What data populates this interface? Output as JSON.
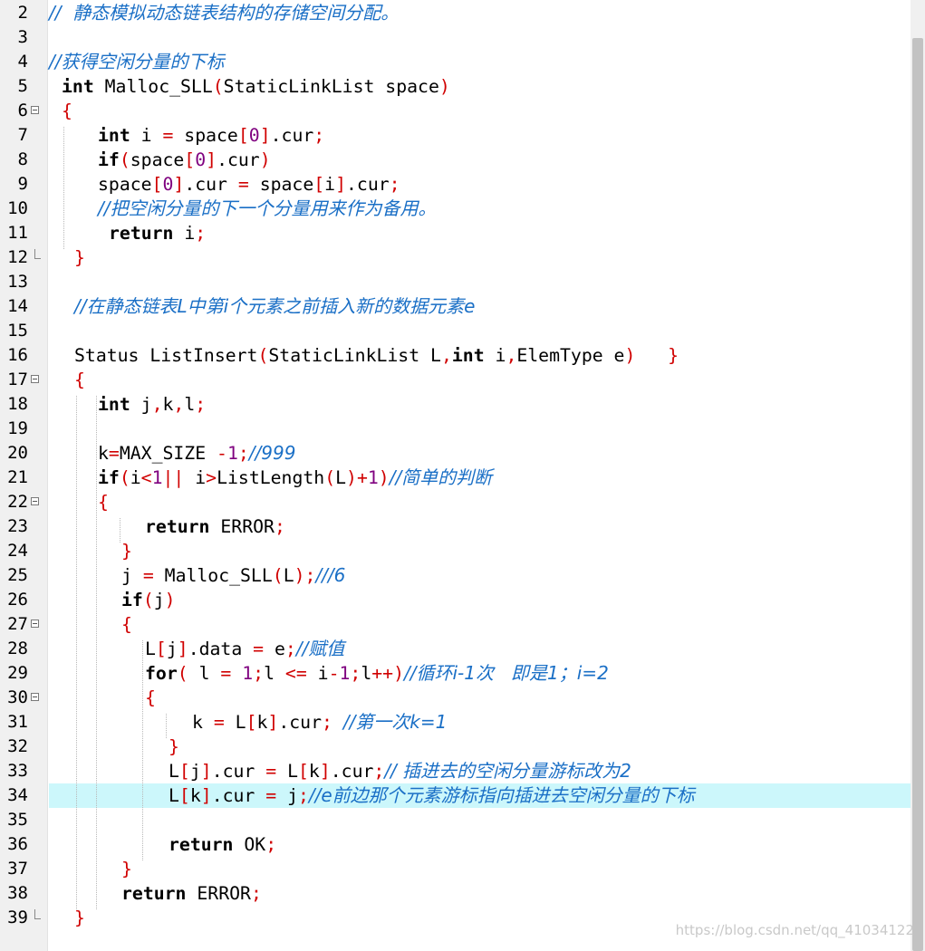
{
  "editor": {
    "current_line": "34",
    "lines": [
      {
        "n": "2",
        "segs": [
          [
            "c",
            "//  静态模拟动态链表结构的存储空间分配。"
          ]
        ]
      },
      {
        "n": "3",
        "segs": []
      },
      {
        "n": "4",
        "segs": [
          [
            "c",
            "//获得空闲分量的下标"
          ]
        ]
      },
      {
        "n": "5",
        "segs": [
          [
            "k",
            "int"
          ],
          [
            "t",
            " Malloc_SLL"
          ],
          [
            "p",
            "("
          ],
          [
            "t",
            "StaticLinkList space"
          ],
          [
            "p",
            ")"
          ]
        ]
      },
      {
        "n": "6",
        "segs": [
          [
            "p",
            "{"
          ]
        ]
      },
      {
        "n": "7",
        "segs": [
          [
            "k",
            "int"
          ],
          [
            "t",
            " i "
          ],
          [
            "p",
            "="
          ],
          [
            "t",
            " space"
          ],
          [
            "p",
            "["
          ],
          [
            "n",
            "0"
          ],
          [
            "p",
            "]"
          ],
          [
            "t",
            ".cur"
          ],
          [
            "p",
            ";"
          ]
        ]
      },
      {
        "n": "8",
        "segs": [
          [
            "k",
            "if"
          ],
          [
            "p",
            "("
          ],
          [
            "t",
            "space"
          ],
          [
            "p",
            "["
          ],
          [
            "n",
            "0"
          ],
          [
            "p",
            "]"
          ],
          [
            "t",
            ".cur"
          ],
          [
            "p",
            ")"
          ]
        ]
      },
      {
        "n": "9",
        "segs": [
          [
            "t",
            "space"
          ],
          [
            "p",
            "["
          ],
          [
            "n",
            "0"
          ],
          [
            "p",
            "]"
          ],
          [
            "t",
            ".cur "
          ],
          [
            "p",
            "="
          ],
          [
            "t",
            " space"
          ],
          [
            "p",
            "["
          ],
          [
            "t",
            "i"
          ],
          [
            "p",
            "]"
          ],
          [
            "t",
            ".cur"
          ],
          [
            "p",
            ";"
          ]
        ]
      },
      {
        "n": "10",
        "segs": [
          [
            "c",
            "//把空闲分量的下一个分量用来作为备用。"
          ]
        ]
      },
      {
        "n": "11",
        "segs": [
          [
            "k",
            "return"
          ],
          [
            "t",
            " i"
          ],
          [
            "p",
            ";"
          ]
        ]
      },
      {
        "n": "12",
        "segs": [
          [
            "p",
            "}"
          ]
        ]
      },
      {
        "n": "13",
        "segs": []
      },
      {
        "n": "14",
        "segs": [
          [
            "c",
            "//在静态链表L中第i个元素之前插入新的数据元素e"
          ]
        ]
      },
      {
        "n": "15",
        "segs": []
      },
      {
        "n": "16",
        "segs": [
          [
            "t",
            "Status ListInsert"
          ],
          [
            "p",
            "("
          ],
          [
            "t",
            "StaticLinkList L"
          ],
          [
            "p",
            ","
          ],
          [
            "k",
            "int"
          ],
          [
            "t",
            " i"
          ],
          [
            "p",
            ","
          ],
          [
            "t",
            "ElemType e"
          ],
          [
            "p",
            ")"
          ],
          [
            "t",
            "   "
          ],
          [
            "p",
            "}"
          ]
        ]
      },
      {
        "n": "17",
        "segs": [
          [
            "p",
            "{"
          ]
        ]
      },
      {
        "n": "18",
        "segs": [
          [
            "k",
            "int"
          ],
          [
            "t",
            " j"
          ],
          [
            "p",
            ","
          ],
          [
            "t",
            "k"
          ],
          [
            "p",
            ","
          ],
          [
            "t",
            "l"
          ],
          [
            "p",
            ";"
          ]
        ]
      },
      {
        "n": "19",
        "segs": []
      },
      {
        "n": "20",
        "segs": [
          [
            "t",
            "k"
          ],
          [
            "p",
            "="
          ],
          [
            "t",
            "MAX_SIZE "
          ],
          [
            "p",
            "-"
          ],
          [
            "n",
            "1"
          ],
          [
            "p",
            ";"
          ],
          [
            "c",
            "//999"
          ]
        ]
      },
      {
        "n": "21",
        "segs": [
          [
            "k",
            "if"
          ],
          [
            "p",
            "("
          ],
          [
            "t",
            "i"
          ],
          [
            "p",
            "<"
          ],
          [
            "n",
            "1"
          ],
          [
            "p",
            "||"
          ],
          [
            "t",
            " i"
          ],
          [
            "p",
            ">"
          ],
          [
            "t",
            "ListLength"
          ],
          [
            "p",
            "("
          ],
          [
            "t",
            "L"
          ],
          [
            "p",
            ")+"
          ],
          [
            "n",
            "1"
          ],
          [
            "p",
            ")"
          ],
          [
            "c",
            "//简单的判断"
          ]
        ]
      },
      {
        "n": "22",
        "segs": [
          [
            "p",
            "{"
          ]
        ]
      },
      {
        "n": "23",
        "segs": [
          [
            "k",
            "return"
          ],
          [
            "t",
            " ERROR"
          ],
          [
            "p",
            ";"
          ]
        ]
      },
      {
        "n": "24",
        "segs": [
          [
            "p",
            "}"
          ]
        ]
      },
      {
        "n": "25",
        "segs": [
          [
            "t",
            "j "
          ],
          [
            "p",
            "="
          ],
          [
            "t",
            " Malloc_SLL"
          ],
          [
            "p",
            "("
          ],
          [
            "t",
            "L"
          ],
          [
            "p",
            ");"
          ],
          [
            "c",
            "///6"
          ]
        ]
      },
      {
        "n": "26",
        "segs": [
          [
            "k",
            "if"
          ],
          [
            "p",
            "("
          ],
          [
            "t",
            "j"
          ],
          [
            "p",
            ")"
          ]
        ]
      },
      {
        "n": "27",
        "segs": [
          [
            "p",
            "{"
          ]
        ]
      },
      {
        "n": "28",
        "segs": [
          [
            "t",
            "L"
          ],
          [
            "p",
            "["
          ],
          [
            "t",
            "j"
          ],
          [
            "p",
            "]"
          ],
          [
            "t",
            ".data "
          ],
          [
            "p",
            "="
          ],
          [
            "t",
            " e"
          ],
          [
            "p",
            ";"
          ],
          [
            "c",
            "//赋值"
          ]
        ]
      },
      {
        "n": "29",
        "segs": [
          [
            "k",
            "for"
          ],
          [
            "p",
            "("
          ],
          [
            "t",
            " l "
          ],
          [
            "p",
            "="
          ],
          [
            "t",
            " "
          ],
          [
            "n",
            "1"
          ],
          [
            "p",
            ";"
          ],
          [
            "t",
            "l "
          ],
          [
            "p",
            "<="
          ],
          [
            "t",
            " i"
          ],
          [
            "p",
            "-"
          ],
          [
            "n",
            "1"
          ],
          [
            "p",
            ";"
          ],
          [
            "t",
            "l"
          ],
          [
            "p",
            "++)"
          ],
          [
            "c",
            "//循环i-1次   即是1；i=2"
          ]
        ]
      },
      {
        "n": "30",
        "segs": [
          [
            "p",
            "{"
          ]
        ]
      },
      {
        "n": "31",
        "segs": [
          [
            "t",
            "k "
          ],
          [
            "p",
            "="
          ],
          [
            "t",
            " L"
          ],
          [
            "p",
            "["
          ],
          [
            "t",
            "k"
          ],
          [
            "p",
            "]"
          ],
          [
            "t",
            ".cur"
          ],
          [
            "p",
            ";"
          ],
          [
            "t",
            " "
          ],
          [
            "c",
            "//第一次k=1"
          ]
        ]
      },
      {
        "n": "32",
        "segs": [
          [
            "p",
            "}"
          ]
        ]
      },
      {
        "n": "33",
        "segs": [
          [
            "t",
            "L"
          ],
          [
            "p",
            "["
          ],
          [
            "t",
            "j"
          ],
          [
            "p",
            "]"
          ],
          [
            "t",
            ".cur "
          ],
          [
            "p",
            "="
          ],
          [
            "t",
            " L"
          ],
          [
            "p",
            "["
          ],
          [
            "t",
            "k"
          ],
          [
            "p",
            "]"
          ],
          [
            "t",
            ".cur"
          ],
          [
            "p",
            ";"
          ],
          [
            "c",
            "// 插进去的空闲分量游标改为2"
          ]
        ]
      },
      {
        "n": "34",
        "segs": [
          [
            "t",
            "L"
          ],
          [
            "p",
            "["
          ],
          [
            "t",
            "k"
          ],
          [
            "p",
            "]"
          ],
          [
            "t",
            ".cur "
          ],
          [
            "p",
            "="
          ],
          [
            "t",
            " j"
          ],
          [
            "p",
            ";"
          ],
          [
            "c",
            "//e前边那个元素游标指向插进去空闲分量的下标"
          ]
        ]
      },
      {
        "n": "35",
        "segs": []
      },
      {
        "n": "36",
        "segs": [
          [
            "k",
            "return"
          ],
          [
            "t",
            " OK"
          ],
          [
            "p",
            ";"
          ]
        ]
      },
      {
        "n": "37",
        "segs": [
          [
            "p",
            "}"
          ]
        ]
      },
      {
        "n": "38",
        "segs": [
          [
            "k",
            "return"
          ],
          [
            "t",
            " ERROR"
          ],
          [
            "p",
            ";"
          ]
        ]
      },
      {
        "n": "39",
        "segs": [
          [
            "p",
            "}"
          ]
        ]
      }
    ]
  },
  "watermark": "https://blog.csdn.net/qq_41034122",
  "colors": {
    "keyword": "#000000",
    "punctuation": "#d00000",
    "number": "#7f007f",
    "comment": "#1a6fc6",
    "current_line_bg": "#ccf7fb",
    "gutter_bg": "#f0f0f0"
  }
}
